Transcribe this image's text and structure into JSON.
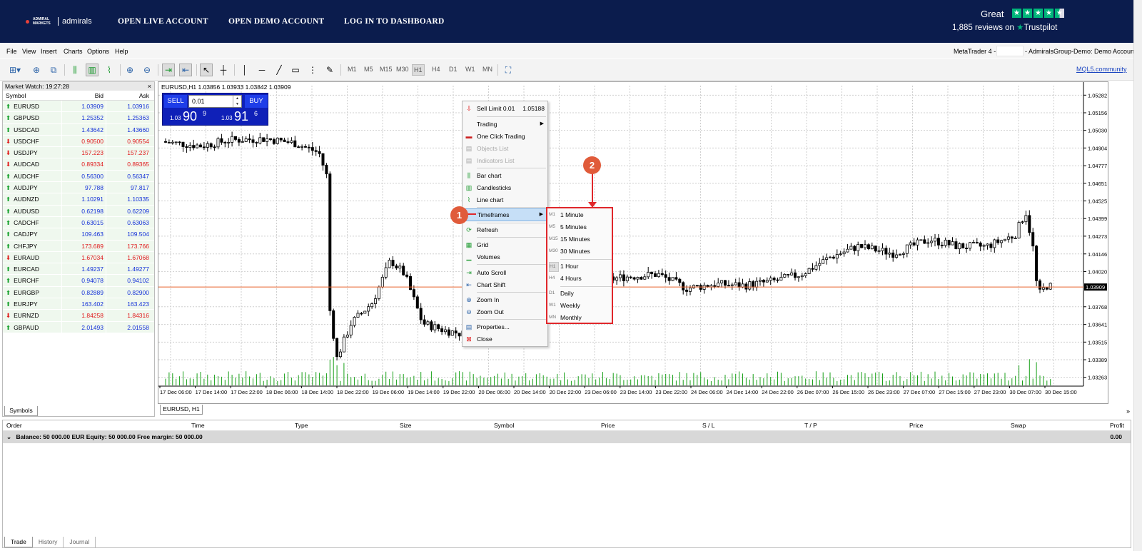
{
  "banner": {
    "logo_small": "ADMIRAL MARKETS",
    "logo_text": "admirals",
    "nav": [
      "OPEN LIVE ACCOUNT",
      "OPEN DEMO ACCOUNT",
      "LOG IN TO DASHBOARD"
    ],
    "trustpilot_rating": "Great",
    "trustpilot_reviews": "1,885 reviews on",
    "trustpilot_brand": "Trustpilot",
    "star_color": "#00b67a"
  },
  "menubar": {
    "items": [
      "File",
      "View",
      "Insert",
      "Charts",
      "Options",
      "Help"
    ],
    "title_left": "MetaTrader 4 -",
    "title_right": "- AdmiralsGroup-Demo: Demo Account"
  },
  "toolbar": {
    "timeframes": [
      "M1",
      "M5",
      "M15",
      "M30",
      "H1",
      "H4",
      "D1",
      "W1",
      "MN"
    ],
    "active_timeframe": "H1",
    "mql_link": "MQL5.community"
  },
  "market_watch": {
    "title": "Market Watch: 19:27:28",
    "columns": [
      "Symbol",
      "Bid",
      "Ask"
    ],
    "rows": [
      {
        "symbol": "EURUSD",
        "bid": "1.03909",
        "ask": "1.03916",
        "dir": "up",
        "color": "blue"
      },
      {
        "symbol": "GBPUSD",
        "bid": "1.25352",
        "ask": "1.25363",
        "dir": "up",
        "color": "blue"
      },
      {
        "symbol": "USDCAD",
        "bid": "1.43642",
        "ask": "1.43660",
        "dir": "up",
        "color": "blue"
      },
      {
        "symbol": "USDCHF",
        "bid": "0.90500",
        "ask": "0.90554",
        "dir": "down",
        "color": "red"
      },
      {
        "symbol": "USDJPY",
        "bid": "157.223",
        "ask": "157.237",
        "dir": "down",
        "color": "red"
      },
      {
        "symbol": "AUDCAD",
        "bid": "0.89334",
        "ask": "0.89365",
        "dir": "down",
        "color": "red"
      },
      {
        "symbol": "AUDCHF",
        "bid": "0.56300",
        "ask": "0.56347",
        "dir": "up",
        "color": "blue"
      },
      {
        "symbol": "AUDJPY",
        "bid": "97.788",
        "ask": "97.817",
        "dir": "up",
        "color": "blue"
      },
      {
        "symbol": "AUDNZD",
        "bid": "1.10291",
        "ask": "1.10335",
        "dir": "up",
        "color": "blue"
      },
      {
        "symbol": "AUDUSD",
        "bid": "0.62198",
        "ask": "0.62209",
        "dir": "up",
        "color": "blue"
      },
      {
        "symbol": "CADCHF",
        "bid": "0.63015",
        "ask": "0.63063",
        "dir": "up",
        "color": "blue"
      },
      {
        "symbol": "CADJPY",
        "bid": "109.463",
        "ask": "109.504",
        "dir": "up",
        "color": "blue"
      },
      {
        "symbol": "CHFJPY",
        "bid": "173.689",
        "ask": "173.766",
        "dir": "up",
        "color": "red"
      },
      {
        "symbol": "EURAUD",
        "bid": "1.67034",
        "ask": "1.67068",
        "dir": "down",
        "color": "red"
      },
      {
        "symbol": "EURCAD",
        "bid": "1.49237",
        "ask": "1.49277",
        "dir": "up",
        "color": "blue"
      },
      {
        "symbol": "EURCHF",
        "bid": "0.94078",
        "ask": "0.94102",
        "dir": "up",
        "color": "blue"
      },
      {
        "symbol": "EURGBP",
        "bid": "0.82889",
        "ask": "0.82900",
        "dir": "up",
        "color": "blue"
      },
      {
        "symbol": "EURJPY",
        "bid": "163.402",
        "ask": "163.423",
        "dir": "up",
        "color": "blue"
      },
      {
        "symbol": "EURNZD",
        "bid": "1.84258",
        "ask": "1.84316",
        "dir": "down",
        "color": "red"
      },
      {
        "symbol": "GBPAUD",
        "bid": "2.01493",
        "ask": "2.01558",
        "dir": "up",
        "color": "blue"
      }
    ],
    "tab": "Symbols"
  },
  "chart": {
    "info": "EURUSD,H1  1.03856 1.03933 1.03842 1.03909",
    "tab": "EURUSD, H1",
    "current_price": "1.03909",
    "price_labels": [
      "1.05282",
      "1.05156",
      "1.05030",
      "1.04904",
      "1.04777",
      "1.04651",
      "1.04525",
      "1.04399",
      "1.04273",
      "1.04146",
      "1.04020",
      "1.03768",
      "1.03641",
      "1.03515",
      "1.03389",
      "1.03263"
    ],
    "time_labels": [
      "17 Dec 06:00",
      "17 Dec 14:00",
      "17 Dec 22:00",
      "18 Dec 06:00",
      "18 Dec 14:00",
      "18 Dec 22:00",
      "19 Dec 06:00",
      "19 Dec 14:00",
      "19 Dec 22:00",
      "20 Dec 06:00",
      "20 Dec 14:00",
      "20 Dec 22:00",
      "23 Dec 06:00",
      "23 Dec 14:00",
      "23 Dec 22:00",
      "24 Dec 06:00",
      "24 Dec 14:00",
      "24 Dec 22:00",
      "26 Dec 07:00",
      "26 Dec 15:00",
      "26 Dec 23:00",
      "27 Dec 07:00",
      "27 Dec 15:00",
      "27 Dec 23:00",
      "30 Dec 07:00",
      "30 Dec 15:00"
    ],
    "price_line_color": "#e8632f",
    "volume_color": "#18a018",
    "one_click": {
      "sell_label": "SELL",
      "buy_label": "BUY",
      "lot": "0.01",
      "sell_small": "1.03",
      "sell_big": "90",
      "sell_sup": "9",
      "buy_small": "1.03",
      "buy_big": "91",
      "buy_sup": "6"
    }
  },
  "context_menu": {
    "items": [
      {
        "label": "Sell Limit 0.01",
        "value": "1.05188",
        "icon": "sell-limit-icon"
      },
      {
        "label": "Trading",
        "submenu": true,
        "icon": "none"
      },
      {
        "label": "One Click Trading",
        "icon": "one-click-icon"
      },
      {
        "label": "Objects List",
        "disabled": true,
        "icon": "objects-list-icon"
      },
      {
        "label": "Indicators List",
        "disabled": true,
        "icon": "indicators-list-icon"
      },
      {
        "label": "Bar chart",
        "icon": "bar-chart-icon"
      },
      {
        "label": "Candlesticks",
        "icon": "candlesticks-icon"
      },
      {
        "label": "Line chart",
        "icon": "line-chart-icon"
      },
      {
        "label": "Timeframes",
        "submenu": true,
        "highlighted": true,
        "icon": "none"
      },
      {
        "label": "Refresh",
        "icon": "refresh-icon"
      },
      {
        "label": "Grid",
        "icon": "grid-icon"
      },
      {
        "label": "Volumes",
        "icon": "volumes-icon"
      },
      {
        "label": "Auto Scroll",
        "icon": "auto-scroll-icon"
      },
      {
        "label": "Chart Shift",
        "icon": "chart-shift-icon"
      },
      {
        "label": "Zoom In",
        "icon": "zoom-in-icon"
      },
      {
        "label": "Zoom Out",
        "icon": "zoom-out-icon"
      },
      {
        "label": "Properties...",
        "icon": "properties-icon"
      },
      {
        "label": "Close",
        "icon": "close-icon"
      }
    ]
  },
  "timeframes_submenu": {
    "items": [
      {
        "code": "M1",
        "label": "1 Minute"
      },
      {
        "code": "M5",
        "label": "5 Minutes"
      },
      {
        "code": "M15",
        "label": "15 Minutes"
      },
      {
        "code": "M30",
        "label": "30 Minutes"
      },
      {
        "code": "H1",
        "label": "1 Hour",
        "active": true
      },
      {
        "code": "H4",
        "label": "4 Hours"
      },
      {
        "code": "D1",
        "label": "Daily"
      },
      {
        "code": "W1",
        "label": "Weekly"
      },
      {
        "code": "MN",
        "label": "Monthly"
      }
    ],
    "border_color": "#e0272b"
  },
  "callouts": {
    "step1": "1",
    "step2": "2",
    "color": "#e05b3a"
  },
  "terminal": {
    "columns": [
      "Order",
      "Time",
      "Type",
      "Size",
      "Symbol",
      "Price",
      "S / L",
      "T / P",
      "Price",
      "Swap",
      "Profit"
    ],
    "balance_text": "Balance: 50 000.00 EUR  Equity: 50 000.00  Free margin: 50 000.00",
    "profit": "0.00",
    "tabs": [
      "Trade",
      "History",
      "Journal"
    ],
    "active_tab": "Trade"
  }
}
